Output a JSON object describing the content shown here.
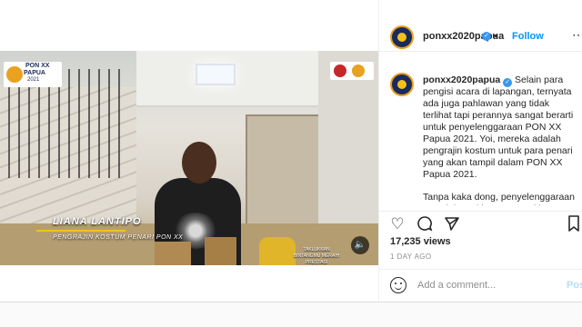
{
  "post": {
    "username": "ponxx2020papua",
    "follow_label": "Follow",
    "separator": "•",
    "more_icon": "more-options-icon",
    "caption_paragraphs": [
      "Selain para pengisi acara di lapangan, ternyata ada juga pahlawan yang tidak terlihat tapi perannya sangat berarti untuk penyelenggaraan PON XX Papua 2021. Yoi, mereka adalah pengrajin kostum untuk para penari yang akan tampil dalam PON XX Papua 2021.",
      "Tanpa kaka dong, penyelenggaraan PON ini pasti hampa, ayo kita dukung terus pengrajin kostum lokal"
    ],
    "views": "17,235 views",
    "time_ago": "1 DAY AGO",
    "comment_placeholder": "Add a comment...",
    "post_label": "Post"
  },
  "video": {
    "name_title": "LIANA LANTIPO",
    "name_subtitle": "PENGRAJIN KOSTUM PENARI PON XX",
    "logo_line1": "PON XX",
    "logo_line2": "PAPUA",
    "logo_line3": "2021",
    "tagline": "TAKLUKKAN BINTANGMU MERAIH PRESTASI",
    "sound_icon": "speaker-icon"
  },
  "icons": {
    "like": "heart-icon",
    "comment": "comment-icon",
    "share": "share-icon",
    "save": "bookmark-icon",
    "emoji": "emoji-icon",
    "verified": "verified-badge-icon"
  },
  "colors": {
    "accent": "#0095f6",
    "verified": "#3897f0",
    "brand_navy": "#1b2a5c",
    "brand_gold": "#e8a120"
  }
}
